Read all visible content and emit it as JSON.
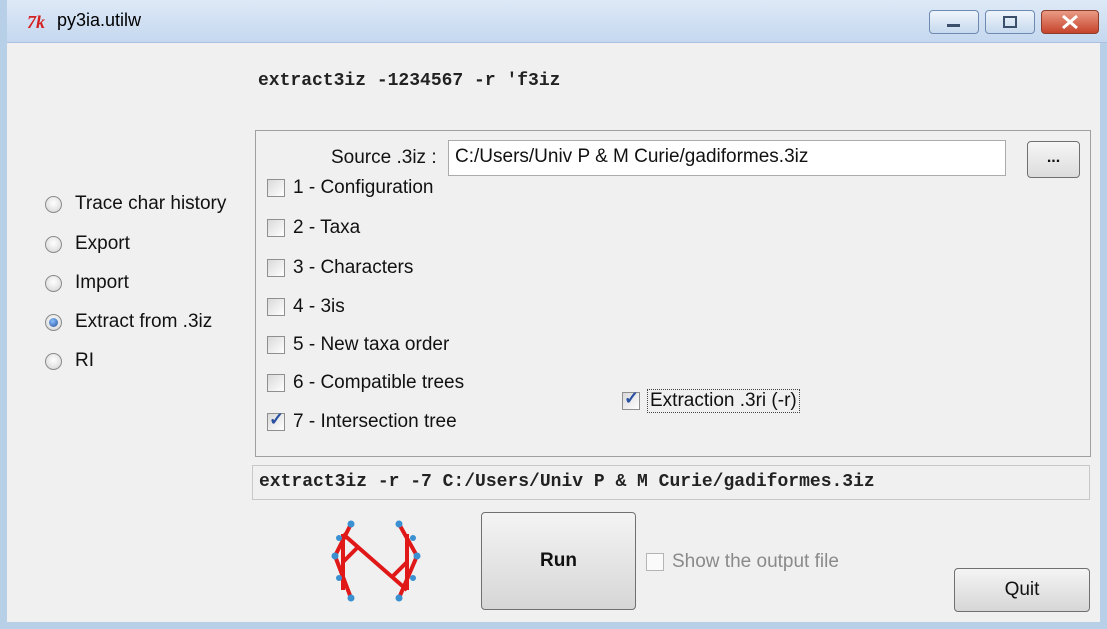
{
  "window": {
    "title": "py3ia.utilw"
  },
  "top_command": "extract3iz -1234567 -r 'f3iz",
  "modes": [
    {
      "label": "Trace char history",
      "selected": false
    },
    {
      "label": "Export",
      "selected": false
    },
    {
      "label": "Import",
      "selected": false
    },
    {
      "label": "Extract from .3iz",
      "selected": true
    },
    {
      "label": "RI",
      "selected": false
    }
  ],
  "source": {
    "label": "Source .3iz :",
    "value": "C:/Users/Univ P & M Curie/gadiformes.3iz",
    "browse_label": "..."
  },
  "options": [
    {
      "label": "1 - Configuration",
      "checked": false
    },
    {
      "label": "2 - Taxa",
      "checked": false
    },
    {
      "label": "3 - Characters",
      "checked": false
    },
    {
      "label": "4 - 3is",
      "checked": false
    },
    {
      "label": "5 - New taxa order",
      "checked": false
    },
    {
      "label": "6 - Compatible trees",
      "checked": false
    },
    {
      "label": "7 - Intersection tree",
      "checked": true
    }
  ],
  "extraction": {
    "label": "Extraction .3ri (-r)",
    "checked": true
  },
  "command_line": "extract3iz -r -7 C:/Users/Univ P & M Curie/gadiformes.3iz",
  "run_label": "Run",
  "show_output": {
    "label": "Show the output file",
    "checked": false
  },
  "quit_label": "Quit",
  "colors": {
    "logo_red": "#e01818",
    "logo_dots": "#3a90d0",
    "titlebar": "#c5d8ef"
  }
}
